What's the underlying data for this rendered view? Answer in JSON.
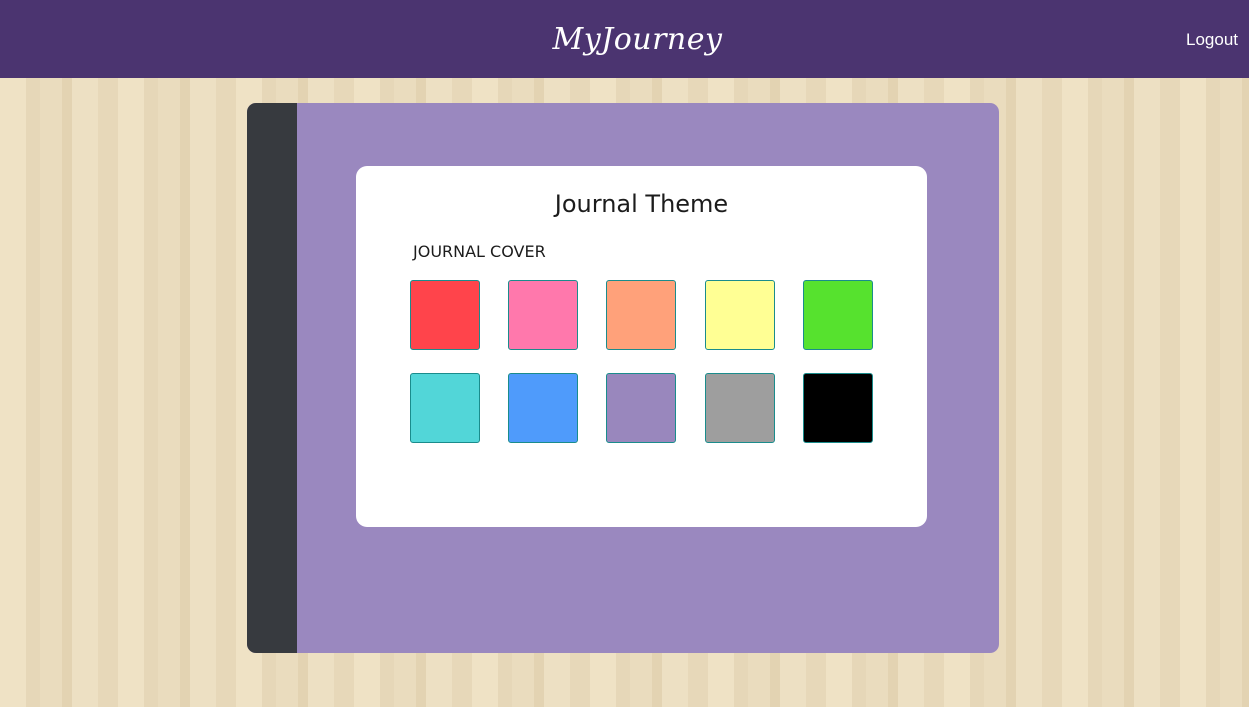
{
  "header": {
    "brand": "MyJourney",
    "logout_label": "Logout"
  },
  "theme_card": {
    "title": "Journal Theme",
    "cover_label": "JOURNAL COVER",
    "swatches": [
      {
        "name": "red",
        "color": "#ff444b"
      },
      {
        "name": "pink",
        "color": "#ff78ac"
      },
      {
        "name": "salmon",
        "color": "#ffa17a"
      },
      {
        "name": "yellow",
        "color": "#ffff94"
      },
      {
        "name": "green",
        "color": "#56e22e"
      },
      {
        "name": "teal",
        "color": "#52d6d8"
      },
      {
        "name": "blue",
        "color": "#4f9bfb"
      },
      {
        "name": "purple",
        "color": "#9987bd"
      },
      {
        "name": "gray",
        "color": "#9e9e9e"
      },
      {
        "name": "black",
        "color": "#000000"
      }
    ]
  },
  "colors": {
    "navbar": "#4b3470",
    "journal_cover": "#9a88bf",
    "spine": "#373a3f"
  }
}
